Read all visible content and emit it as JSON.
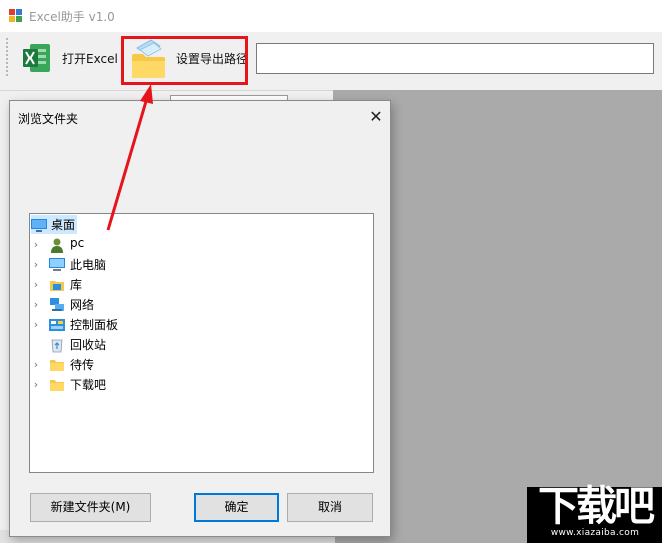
{
  "app": {
    "title": "Excel助手 v1.0",
    "open_excel_label": "打开Excel",
    "set_path_label": "设置导出路径",
    "path_value": ""
  },
  "dialog": {
    "title": "浏览文件夹",
    "close_glyph": "✕",
    "tree": [
      {
        "label": "桌面",
        "icon": "desktop-icon",
        "expandable": false,
        "selected": true
      },
      {
        "label": "pc",
        "icon": "user-icon",
        "expandable": true,
        "selected": false
      },
      {
        "label": "此电脑",
        "icon": "computer-icon",
        "expandable": true,
        "selected": false
      },
      {
        "label": "库",
        "icon": "library-icon",
        "expandable": true,
        "selected": false
      },
      {
        "label": "网络",
        "icon": "network-icon",
        "expandable": true,
        "selected": false
      },
      {
        "label": "控制面板",
        "icon": "control-panel-icon",
        "expandable": true,
        "selected": false
      },
      {
        "label": "回收站",
        "icon": "recycle-bin-icon",
        "expandable": false,
        "selected": false
      },
      {
        "label": "待传",
        "icon": "folder-icon",
        "expandable": true,
        "selected": false
      },
      {
        "label": "下载吧",
        "icon": "folder-icon",
        "expandable": true,
        "selected": false
      }
    ],
    "new_folder_button": "新建文件夹(M)",
    "ok_button": "确定",
    "cancel_button": "取消"
  },
  "watermark": {
    "big_text": "下载吧",
    "url": "www.xiazaiba.com"
  },
  "colors": {
    "highlight": "#e6151b",
    "selection": "#cde8ff",
    "accent": "#0078d7",
    "gray_pane": "#aaaaaa"
  }
}
